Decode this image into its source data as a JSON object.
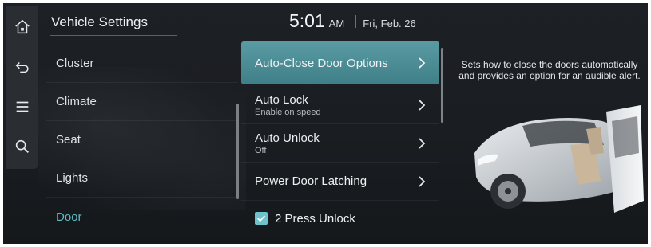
{
  "header": {
    "title": "Vehicle Settings",
    "time": "5:01",
    "ampm": "AM",
    "date": "Fri, Feb. 26"
  },
  "rail": {
    "icons": [
      "home-icon",
      "back-icon",
      "menu-icon",
      "search-icon"
    ]
  },
  "categories": [
    {
      "label": "Cluster"
    },
    {
      "label": "Climate"
    },
    {
      "label": "Seat"
    },
    {
      "label": "Lights"
    },
    {
      "label": "Door",
      "active": true
    }
  ],
  "options": [
    {
      "label": "Auto-Close Door Options",
      "sub": "",
      "highlighted": true
    },
    {
      "label": "Auto Lock",
      "sub": "Enable on speed"
    },
    {
      "label": "Auto Unlock",
      "sub": "Off"
    },
    {
      "label": "Power Door Latching",
      "sub": ""
    },
    {
      "label": "2 Press Unlock",
      "checked": true
    }
  ],
  "description": "Sets how to close the doors automatically and provides an option for an audible alert.",
  "colors": {
    "accent": "#5fb9c6",
    "highlight": "#4a8b93",
    "background": "#1b1e22",
    "rail": "#2a2e33"
  }
}
